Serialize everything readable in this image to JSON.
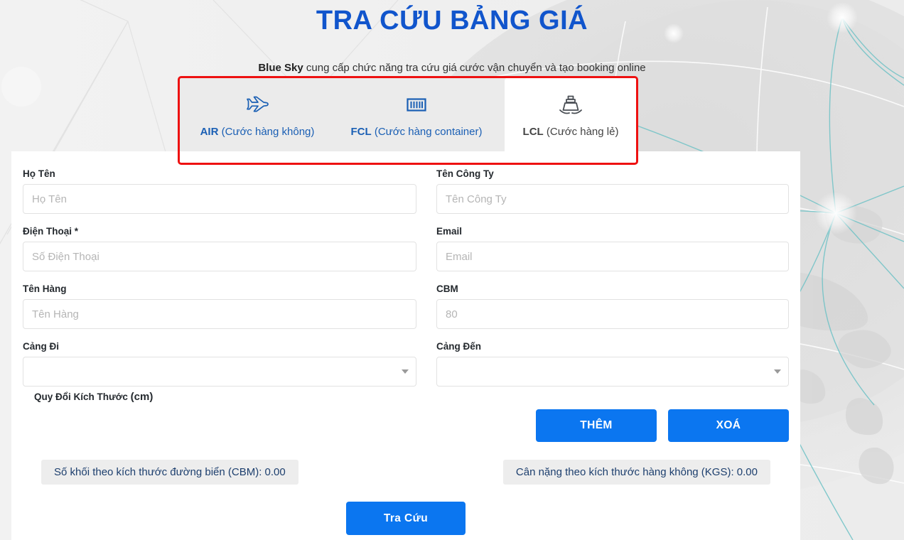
{
  "page": {
    "title": "TRA CỨU BẢNG GIÁ",
    "subtitle_brand": "Blue Sky",
    "subtitle_rest": " cung cấp chức năng tra cứu giá cước vận chuyển và tạo booking online",
    "accent_color": "#1155cc",
    "button_color": "#0b76f0",
    "highlight_color": "#ee1111",
    "background_color": "#f0f0f0"
  },
  "tabs": [
    {
      "code": "AIR",
      "desc": " (Cước hàng không)",
      "icon": "airplane-icon",
      "active": false
    },
    {
      "code": "FCL",
      "desc": " (Cước hàng container)",
      "icon": "container-icon",
      "active": false
    },
    {
      "code": "LCL",
      "desc": " (Cước hàng lẻ)",
      "icon": "ship-icon",
      "active": true
    }
  ],
  "form": {
    "fields": [
      {
        "label": "Họ Tên",
        "placeholder": "Họ Tên",
        "value": ""
      },
      {
        "label": "Tên Công Ty",
        "placeholder": "Tên Công Ty",
        "value": ""
      },
      {
        "label": "Điện Thoại *",
        "placeholder": "Số Điện Thoại",
        "value": ""
      },
      {
        "label": "Email",
        "placeholder": "Email",
        "value": ""
      },
      {
        "label": "Tên Hàng",
        "placeholder": "Tên Hàng",
        "value": ""
      },
      {
        "label": "CBM",
        "placeholder": "80",
        "value": ""
      }
    ],
    "selects": [
      {
        "label": "Cảng Đi",
        "value": ""
      },
      {
        "label": "Cảng Đến",
        "value": ""
      }
    ],
    "dimensions_title": "Quy Đổi Kích Thước ",
    "dimensions_unit": "(cm)"
  },
  "actions": {
    "add_label": "THÊM",
    "clear_label": "XOÁ",
    "submit_label": "Tra Cứu"
  },
  "results": {
    "cbm_badge": "Số khối theo kích thước đường biển (CBM): 0.00",
    "kgs_badge": "Cân nặng theo kích thước hàng không (KGS): 0.00"
  }
}
